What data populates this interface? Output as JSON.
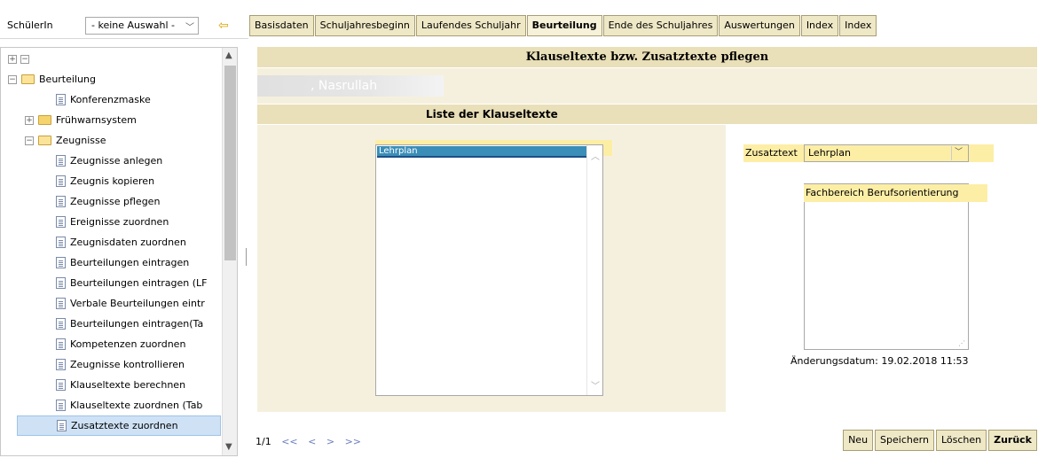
{
  "student": {
    "label": "SchülerIn",
    "selected": "- keine Auswahl -"
  },
  "tabs": [
    {
      "label": "Basisdaten"
    },
    {
      "label": "Schuljahresbeginn"
    },
    {
      "label": "Laufendes Schuljahr"
    },
    {
      "label": "Beurteilung"
    },
    {
      "label": "Ende des Schuljahres"
    },
    {
      "label": "Auswertungen"
    },
    {
      "label": "Index"
    },
    {
      "label": "Index"
    }
  ],
  "active_tab": "Beurteilung",
  "tree": [
    {
      "label": "Beurteilung",
      "type": "folder-open",
      "expander": "−"
    },
    {
      "label": "Konferenzmaske",
      "type": "doc"
    },
    {
      "label": "Frühwarnsystem",
      "type": "folder",
      "expander": "+"
    },
    {
      "label": "Zeugnisse",
      "type": "folder-open",
      "expander": "−"
    },
    {
      "label": "Zeugnisse anlegen",
      "type": "doc"
    },
    {
      "label": "Zeugnis kopieren",
      "type": "doc"
    },
    {
      "label": "Zeugnisse pflegen",
      "type": "doc"
    },
    {
      "label": "Ereignisse zuordnen",
      "type": "doc"
    },
    {
      "label": "Zeugnisdaten zuordnen",
      "type": "doc"
    },
    {
      "label": "Beurteilungen eintragen",
      "type": "doc"
    },
    {
      "label": "Beurteilungen eintragen (LF",
      "type": "doc"
    },
    {
      "label": "Verbale Beurteilungen eintr",
      "type": "doc"
    },
    {
      "label": "Beurteilungen eintragen(Ta",
      "type": "doc"
    },
    {
      "label": "Kompetenzen zuordnen",
      "type": "doc"
    },
    {
      "label": "Zeugnisse kontrollieren",
      "type": "doc"
    },
    {
      "label": "Klauseltexte berechnen",
      "type": "doc"
    },
    {
      "label": "Klauseltexte zuordnen (Tab",
      "type": "doc"
    },
    {
      "label": "Zusatztexte zuordnen",
      "type": "doc",
      "selected": true
    }
  ],
  "main": {
    "title": "Klauseltexte bzw. Zusatztexte pflegen",
    "student_name": ", Nasrullah",
    "list_header": "Liste der Klauseltexte",
    "klausel_items": [
      "Lehrplan"
    ],
    "zusatz_label": "Zusatztext",
    "zusatz_selected": "Lehrplan",
    "text_value": "Fachbereich Berufsorientierung",
    "change_date": "Änderungsdatum: 19.02.2018 11:53",
    "pager": "1/1"
  },
  "buttons": {
    "new": "Neu",
    "save": "Speichern",
    "delete": "Löschen",
    "back": "Zurück"
  },
  "colors": {
    "tab_bg": "#efe8c6",
    "header_bg": "#e9dfb8",
    "panel_bg": "#f5f0de",
    "highlight": "#fdeea6",
    "selection": "#3a8eb8"
  }
}
